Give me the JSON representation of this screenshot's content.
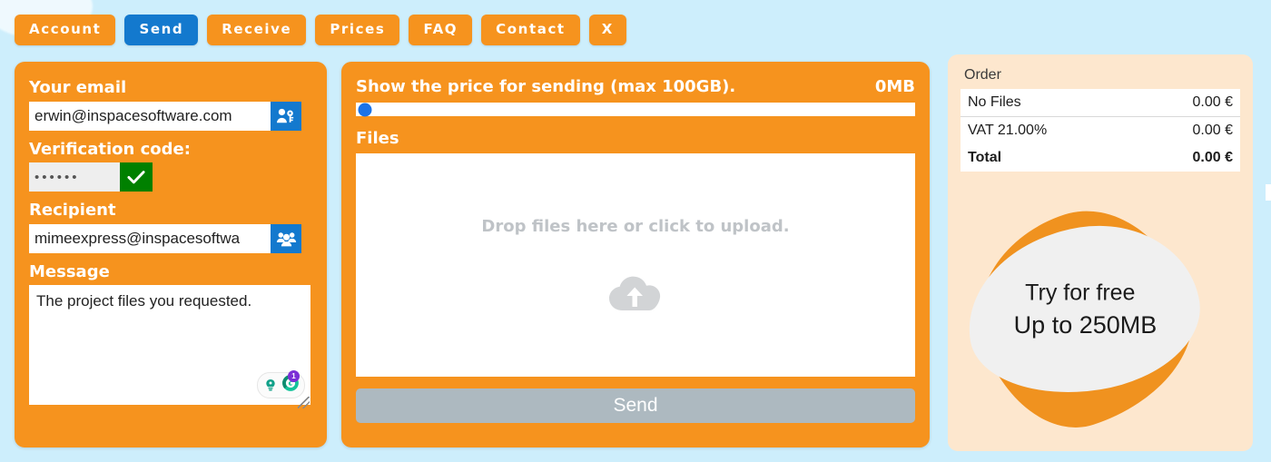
{
  "nav": {
    "items": [
      {
        "label": "Account",
        "active": false
      },
      {
        "label": "Send",
        "active": true
      },
      {
        "label": "Receive",
        "active": false
      },
      {
        "label": "Prices",
        "active": false
      },
      {
        "label": "FAQ",
        "active": false
      },
      {
        "label": "Contact",
        "active": false
      },
      {
        "label": "X",
        "active": false
      }
    ]
  },
  "colors": {
    "brand_orange": "#f6931e",
    "accent_blue": "#1379ce",
    "confirm_green": "#008000",
    "page_background": "#cdeefc",
    "order_background": "#fde7ce",
    "disabled_gray": "#adb9c0"
  },
  "left_panel": {
    "email_label": "Your email",
    "email_value": "erwin@inspacesoftware.com",
    "email_placeholder": "Your email",
    "email_icon": "user-key-icon",
    "code_label": "Verification code:",
    "code_value": "••••••",
    "code_placeholder": "Code",
    "code_confirm_icon": "check-icon",
    "recipient_label": "Recipient",
    "recipient_value": "mimeexpress@inspacesoftwa",
    "recipient_placeholder": "Recipient",
    "recipient_icon": "contacts-icon",
    "message_label": "Message",
    "message_value": "The project files you requested.",
    "message_placeholder": "Message",
    "grammarly": {
      "assistant_icon": "lightbulb-icon",
      "logo_icon": "grammarly-g-icon",
      "alert_count": "1"
    }
  },
  "center_panel": {
    "price_label": "Show the price for sending (max 100GB).",
    "size_value": "0MB",
    "slider": {
      "name": "size-slider",
      "value": 0,
      "min": 0,
      "max": 100,
      "unit": "GB"
    },
    "files_label": "Files",
    "dropzone_text": "Drop files here or click to upload.",
    "dropzone_icon": "cloud-upload-icon",
    "send_label": "Send",
    "send_enabled": false
  },
  "order_panel": {
    "title": "Order",
    "rows": [
      {
        "label": "No Files",
        "amount": "0.00 €",
        "total": false
      },
      {
        "label": "VAT 21.00%",
        "amount": "0.00 €",
        "total": false
      },
      {
        "label": "Total",
        "amount": "0.00 €",
        "total": true
      }
    ],
    "promo": {
      "line1": "Try for free",
      "line2": "Up to 250MB"
    }
  }
}
